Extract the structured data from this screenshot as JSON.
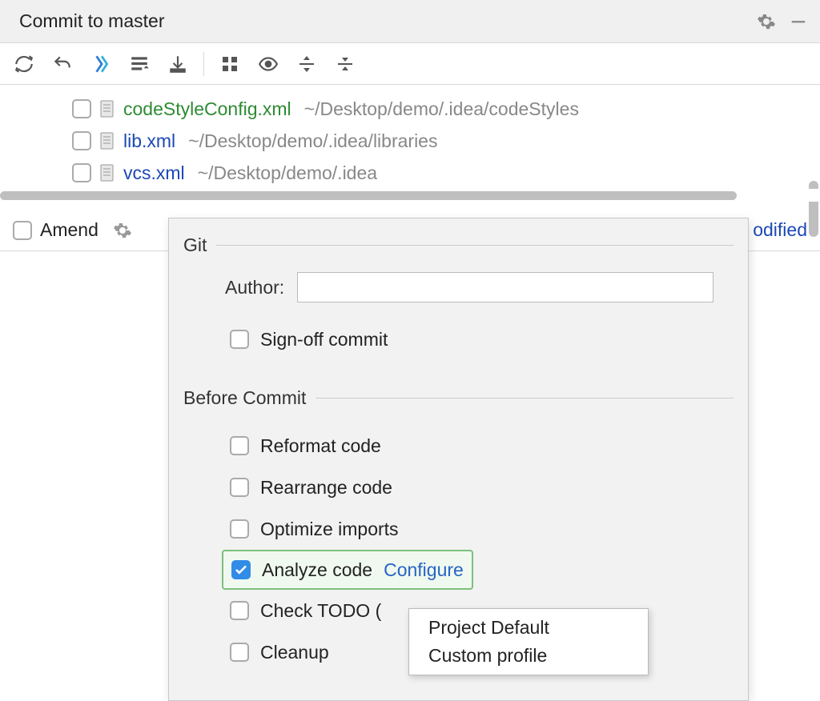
{
  "titlebar": {
    "title": "Commit to master"
  },
  "files": [
    {
      "name": "codeStyleConfig.xml",
      "path": "~/Desktop/demo/.idea/codeStyles",
      "status": "added"
    },
    {
      "name": "lib.xml",
      "path": "~/Desktop/demo/.idea/libraries",
      "status": "modified"
    },
    {
      "name": "vcs.xml",
      "path": "~/Desktop/demo/.idea",
      "status": "modified"
    }
  ],
  "amend": {
    "label": "Amend",
    "modified_partial": "odified"
  },
  "popup": {
    "git_section": "Git",
    "author_label": "Author:",
    "author_value": "",
    "signoff_label": "Sign-off commit",
    "before_section": "Before Commit",
    "options": {
      "reformat": "Reformat code",
      "rearrange": "Rearrange code",
      "optimize": "Optimize imports",
      "analyze": "Analyze code",
      "configure": "Configure",
      "todo": "Check TODO (",
      "cleanup": "Cleanup"
    },
    "analyze_checked": true
  },
  "menu": {
    "items": [
      "Project Default",
      "Custom profile"
    ]
  }
}
